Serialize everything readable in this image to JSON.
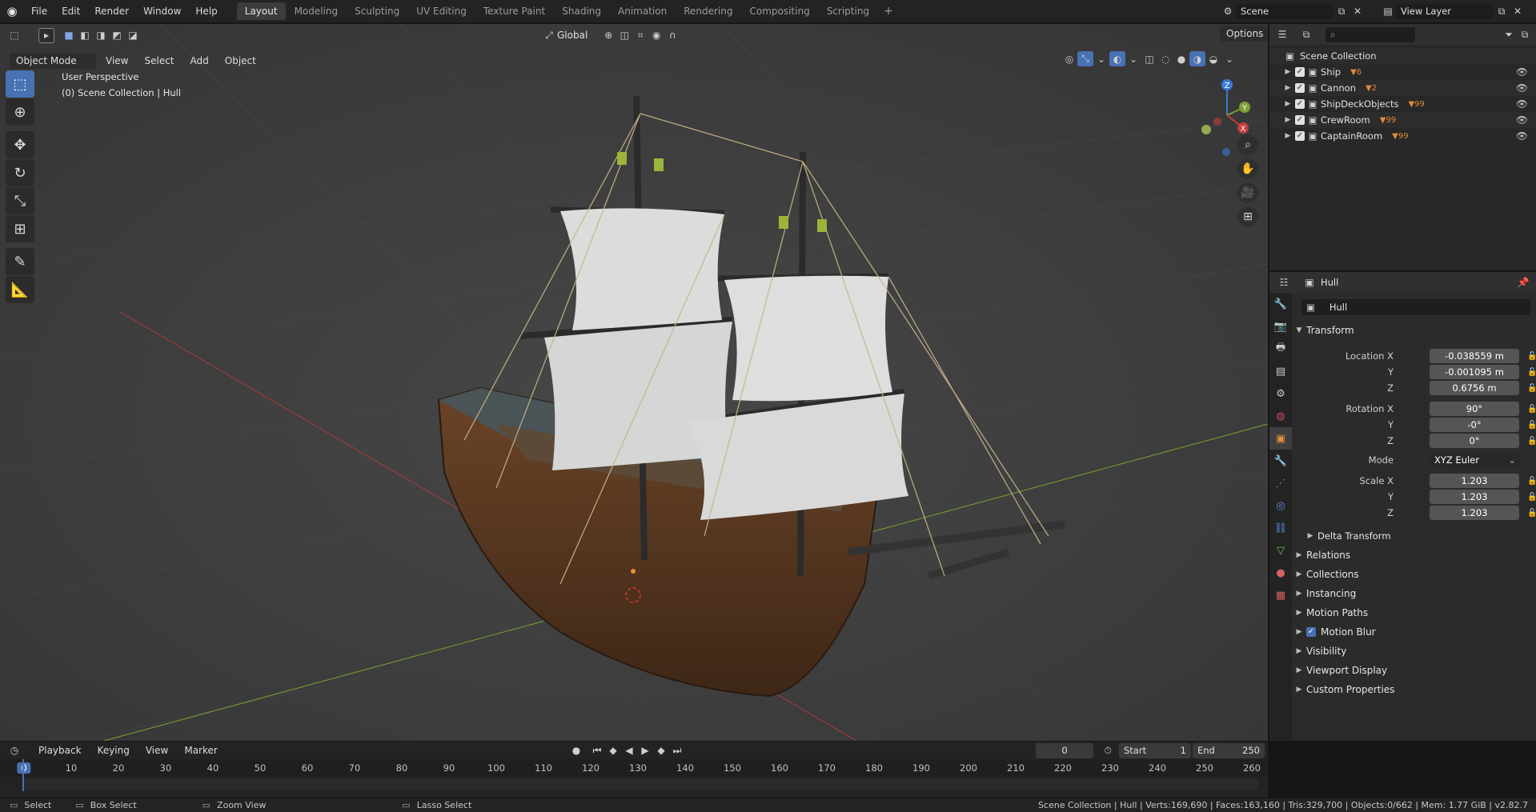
{
  "topbar": {
    "menus": [
      "File",
      "Edit",
      "Render",
      "Window",
      "Help"
    ],
    "workspaces": [
      "Layout",
      "Modeling",
      "Sculpting",
      "UV Editing",
      "Texture Paint",
      "Shading",
      "Animation",
      "Rendering",
      "Compositing",
      "Scripting"
    ],
    "active_workspace": "Layout",
    "scene_label": "Scene",
    "view_layer_label": "View Layer"
  },
  "viewport": {
    "mode": "Object Mode",
    "menus": [
      "View",
      "Select",
      "Add",
      "Object"
    ],
    "orientation": "Global",
    "options_label": "Options",
    "perspective_label": "User Perspective",
    "collection_label": "(0) Scene Collection | Hull",
    "gizmo_axes": {
      "x": "X",
      "y": "Y",
      "z": "Z"
    }
  },
  "outliner": {
    "root": "Scene Collection",
    "items": [
      {
        "name": "Ship",
        "badge": "6"
      },
      {
        "name": "Cannon",
        "badge": "2"
      },
      {
        "name": "ShipDeckObjects",
        "badge": "99"
      },
      {
        "name": "CrewRoom",
        "badge": "99"
      },
      {
        "name": "CaptainRoom",
        "badge": "99"
      }
    ]
  },
  "properties": {
    "object_name_header": "Hull",
    "object_name_field": "Hull",
    "transform_title": "Transform",
    "location": {
      "label_x": "Location X",
      "label_y": "Y",
      "label_z": "Z",
      "x": "-0.038559 m",
      "y": "-0.001095 m",
      "z": "0.6756 m"
    },
    "rotation": {
      "label_x": "Rotation X",
      "label_y": "Y",
      "label_z": "Z",
      "x": "90°",
      "y": "-0°",
      "z": "0°"
    },
    "mode_label": "Mode",
    "mode_value": "XYZ Euler",
    "scale": {
      "label_x": "Scale X",
      "label_y": "Y",
      "label_z": "Z",
      "x": "1.203",
      "y": "1.203",
      "z": "1.203"
    },
    "delta_transform": "Delta Transform",
    "panels": [
      "Relations",
      "Collections",
      "Instancing",
      "Motion Paths",
      "Motion Blur",
      "Visibility",
      "Viewport Display",
      "Custom Properties"
    ]
  },
  "timeline": {
    "menus": [
      "Playback",
      "Keying",
      "View",
      "Marker"
    ],
    "current_frame": "0",
    "start_label": "Start",
    "start_value": "1",
    "end_label": "End",
    "end_value": "250",
    "ticks": [
      "0",
      "10",
      "20",
      "30",
      "40",
      "50",
      "60",
      "70",
      "80",
      "90",
      "100",
      "110",
      "120",
      "130",
      "140",
      "150",
      "160",
      "170",
      "180",
      "190",
      "200",
      "210",
      "220",
      "230",
      "240",
      "250",
      "260"
    ]
  },
  "statusbar": {
    "select": "Select",
    "box_select": "Box Select",
    "zoom_view": "Zoom View",
    "lasso_select": "Lasso Select",
    "stats": "Scene Collection | Hull | Verts:169,690 | Faces:163,160 | Tris:329,700 | Objects:0/662 | Mem: 1.77 GiB | v2.82.7"
  },
  "colors": {
    "accent": "#4772b3",
    "viewport_bg": "#3d3d3d",
    "x_axis": "#c23f3f",
    "y_axis": "#7ca135",
    "z_axis": "#3d7ad6"
  }
}
